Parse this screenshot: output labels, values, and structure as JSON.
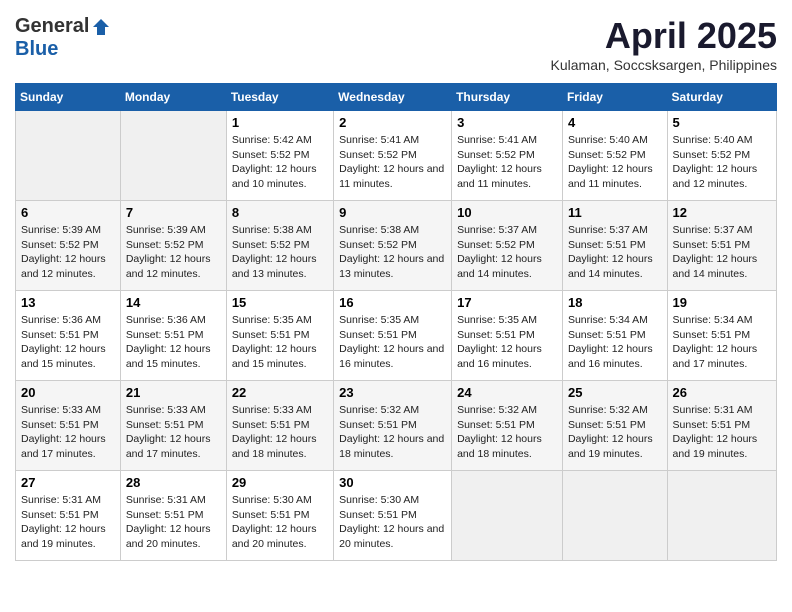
{
  "header": {
    "logo_general": "General",
    "logo_blue": "Blue",
    "month_title": "April 2025",
    "subtitle": "Kulaman, Soccsksargen, Philippines"
  },
  "weekdays": [
    "Sunday",
    "Monday",
    "Tuesday",
    "Wednesday",
    "Thursday",
    "Friday",
    "Saturday"
  ],
  "weeks": [
    [
      {
        "day": "",
        "sunrise": "",
        "sunset": "",
        "daylight": ""
      },
      {
        "day": "",
        "sunrise": "",
        "sunset": "",
        "daylight": ""
      },
      {
        "day": "1",
        "sunrise": "Sunrise: 5:42 AM",
        "sunset": "Sunset: 5:52 PM",
        "daylight": "Daylight: 12 hours and 10 minutes."
      },
      {
        "day": "2",
        "sunrise": "Sunrise: 5:41 AM",
        "sunset": "Sunset: 5:52 PM",
        "daylight": "Daylight: 12 hours and 11 minutes."
      },
      {
        "day": "3",
        "sunrise": "Sunrise: 5:41 AM",
        "sunset": "Sunset: 5:52 PM",
        "daylight": "Daylight: 12 hours and 11 minutes."
      },
      {
        "day": "4",
        "sunrise": "Sunrise: 5:40 AM",
        "sunset": "Sunset: 5:52 PM",
        "daylight": "Daylight: 12 hours and 11 minutes."
      },
      {
        "day": "5",
        "sunrise": "Sunrise: 5:40 AM",
        "sunset": "Sunset: 5:52 PM",
        "daylight": "Daylight: 12 hours and 12 minutes."
      }
    ],
    [
      {
        "day": "6",
        "sunrise": "Sunrise: 5:39 AM",
        "sunset": "Sunset: 5:52 PM",
        "daylight": "Daylight: 12 hours and 12 minutes."
      },
      {
        "day": "7",
        "sunrise": "Sunrise: 5:39 AM",
        "sunset": "Sunset: 5:52 PM",
        "daylight": "Daylight: 12 hours and 12 minutes."
      },
      {
        "day": "8",
        "sunrise": "Sunrise: 5:38 AM",
        "sunset": "Sunset: 5:52 PM",
        "daylight": "Daylight: 12 hours and 13 minutes."
      },
      {
        "day": "9",
        "sunrise": "Sunrise: 5:38 AM",
        "sunset": "Sunset: 5:52 PM",
        "daylight": "Daylight: 12 hours and 13 minutes."
      },
      {
        "day": "10",
        "sunrise": "Sunrise: 5:37 AM",
        "sunset": "Sunset: 5:52 PM",
        "daylight": "Daylight: 12 hours and 14 minutes."
      },
      {
        "day": "11",
        "sunrise": "Sunrise: 5:37 AM",
        "sunset": "Sunset: 5:51 PM",
        "daylight": "Daylight: 12 hours and 14 minutes."
      },
      {
        "day": "12",
        "sunrise": "Sunrise: 5:37 AM",
        "sunset": "Sunset: 5:51 PM",
        "daylight": "Daylight: 12 hours and 14 minutes."
      }
    ],
    [
      {
        "day": "13",
        "sunrise": "Sunrise: 5:36 AM",
        "sunset": "Sunset: 5:51 PM",
        "daylight": "Daylight: 12 hours and 15 minutes."
      },
      {
        "day": "14",
        "sunrise": "Sunrise: 5:36 AM",
        "sunset": "Sunset: 5:51 PM",
        "daylight": "Daylight: 12 hours and 15 minutes."
      },
      {
        "day": "15",
        "sunrise": "Sunrise: 5:35 AM",
        "sunset": "Sunset: 5:51 PM",
        "daylight": "Daylight: 12 hours and 15 minutes."
      },
      {
        "day": "16",
        "sunrise": "Sunrise: 5:35 AM",
        "sunset": "Sunset: 5:51 PM",
        "daylight": "Daylight: 12 hours and 16 minutes."
      },
      {
        "day": "17",
        "sunrise": "Sunrise: 5:35 AM",
        "sunset": "Sunset: 5:51 PM",
        "daylight": "Daylight: 12 hours and 16 minutes."
      },
      {
        "day": "18",
        "sunrise": "Sunrise: 5:34 AM",
        "sunset": "Sunset: 5:51 PM",
        "daylight": "Daylight: 12 hours and 16 minutes."
      },
      {
        "day": "19",
        "sunrise": "Sunrise: 5:34 AM",
        "sunset": "Sunset: 5:51 PM",
        "daylight": "Daylight: 12 hours and 17 minutes."
      }
    ],
    [
      {
        "day": "20",
        "sunrise": "Sunrise: 5:33 AM",
        "sunset": "Sunset: 5:51 PM",
        "daylight": "Daylight: 12 hours and 17 minutes."
      },
      {
        "day": "21",
        "sunrise": "Sunrise: 5:33 AM",
        "sunset": "Sunset: 5:51 PM",
        "daylight": "Daylight: 12 hours and 17 minutes."
      },
      {
        "day": "22",
        "sunrise": "Sunrise: 5:33 AM",
        "sunset": "Sunset: 5:51 PM",
        "daylight": "Daylight: 12 hours and 18 minutes."
      },
      {
        "day": "23",
        "sunrise": "Sunrise: 5:32 AM",
        "sunset": "Sunset: 5:51 PM",
        "daylight": "Daylight: 12 hours and 18 minutes."
      },
      {
        "day": "24",
        "sunrise": "Sunrise: 5:32 AM",
        "sunset": "Sunset: 5:51 PM",
        "daylight": "Daylight: 12 hours and 18 minutes."
      },
      {
        "day": "25",
        "sunrise": "Sunrise: 5:32 AM",
        "sunset": "Sunset: 5:51 PM",
        "daylight": "Daylight: 12 hours and 19 minutes."
      },
      {
        "day": "26",
        "sunrise": "Sunrise: 5:31 AM",
        "sunset": "Sunset: 5:51 PM",
        "daylight": "Daylight: 12 hours and 19 minutes."
      }
    ],
    [
      {
        "day": "27",
        "sunrise": "Sunrise: 5:31 AM",
        "sunset": "Sunset: 5:51 PM",
        "daylight": "Daylight: 12 hours and 19 minutes."
      },
      {
        "day": "28",
        "sunrise": "Sunrise: 5:31 AM",
        "sunset": "Sunset: 5:51 PM",
        "daylight": "Daylight: 12 hours and 20 minutes."
      },
      {
        "day": "29",
        "sunrise": "Sunrise: 5:30 AM",
        "sunset": "Sunset: 5:51 PM",
        "daylight": "Daylight: 12 hours and 20 minutes."
      },
      {
        "day": "30",
        "sunrise": "Sunrise: 5:30 AM",
        "sunset": "Sunset: 5:51 PM",
        "daylight": "Daylight: 12 hours and 20 minutes."
      },
      {
        "day": "",
        "sunrise": "",
        "sunset": "",
        "daylight": ""
      },
      {
        "day": "",
        "sunrise": "",
        "sunset": "",
        "daylight": ""
      },
      {
        "day": "",
        "sunrise": "",
        "sunset": "",
        "daylight": ""
      }
    ]
  ]
}
